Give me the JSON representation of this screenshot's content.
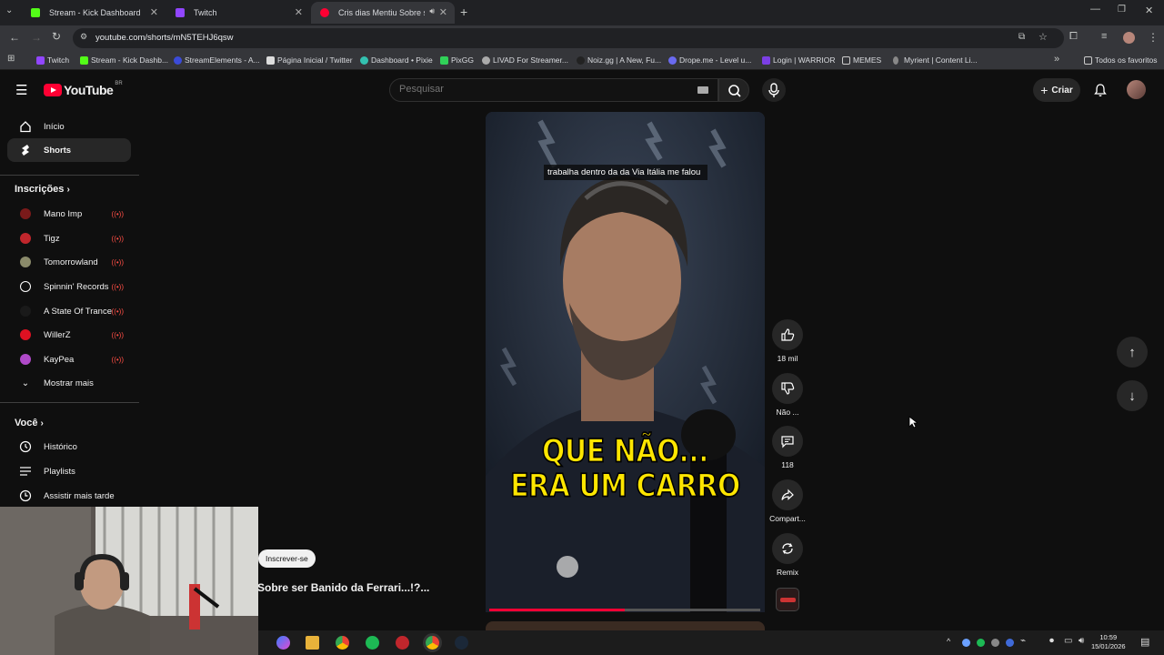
{
  "browser": {
    "tabs": [
      {
        "title": "Stream - Kick Dashboard",
        "favicon_color": "#53fc18"
      },
      {
        "title": "Twitch",
        "favicon_color": "#9146ff"
      },
      {
        "title": "Cris dias Mentiu Sobre ser",
        "favicon_color": "#ff0033"
      }
    ],
    "url": "youtube.com/shorts/mN5TEHJ6qsw",
    "bookmarks": [
      {
        "label": "Twitch",
        "color": "#9146ff"
      },
      {
        "label": "Stream - Kick Dashb...",
        "color": "#53fc18"
      },
      {
        "label": "StreamElements - A...",
        "color": "#3b4bd8"
      },
      {
        "label": "Página Inicial / Twitter",
        "color": "#dddddd"
      },
      {
        "label": "Dashboard • Pixie",
        "color": "#33c1b0"
      },
      {
        "label": "PixGG",
        "color": "#30d158"
      },
      {
        "label": "LIVAD For Streamer...",
        "color": "#aaaaaa"
      },
      {
        "label": "Noiz.gg | A New, Fu...",
        "color": "#222222"
      },
      {
        "label": "Drope.me - Level u...",
        "color": "#6a6af0"
      },
      {
        "label": "Login | WARRIOR",
        "color": "#7b3fe4"
      },
      {
        "label": "MEMES",
        "color": "#cccccc"
      },
      {
        "label": "Myrient | Content Li...",
        "color": "#888888"
      }
    ],
    "all_bookmarks": "Todos os favoritos"
  },
  "youtube": {
    "logo_text": "YouTube",
    "country_code": "BR",
    "search_placeholder": "Pesquisar",
    "create_label": "Criar"
  },
  "sidebar": {
    "home": "Início",
    "shorts": "Shorts",
    "subscriptions_header": "Inscrições",
    "channels": [
      {
        "name": "Mano Imp",
        "color": "#7a1a1a"
      },
      {
        "name": "Tigz",
        "color": "#c0262c"
      },
      {
        "name": "Tomorrowland",
        "color": "#8a8a6a"
      },
      {
        "name": "Spinnin' Records",
        "color": "#111111"
      },
      {
        "name": "A State Of Trance",
        "color": "#1a1a1a"
      },
      {
        "name": "WillerZ",
        "color": "#d12"
      },
      {
        "name": "KayPea",
        "color": "#b04ac9"
      }
    ],
    "show_more": "Mostrar mais",
    "you_header": "Você",
    "history": "Histórico",
    "playlists": "Playlists",
    "watch_later": "Assistir mais tarde"
  },
  "video": {
    "caption": "trabalha dentro da da Via Itália me falou",
    "overlay_line1": "QUE NÃO...",
    "overlay_line2": "ERA UM CARRO",
    "progress": 0.5,
    "subscribe_label": "Inscrever-se",
    "title": "Sobre ser Banido da Ferrari...!?..."
  },
  "actions": {
    "likes": "18 mil",
    "dislike": "Não ...",
    "comments": "118",
    "share": "Compart...",
    "remix": "Remix"
  },
  "taskbar": {
    "time": "10:59",
    "date": "15/01/2026"
  }
}
